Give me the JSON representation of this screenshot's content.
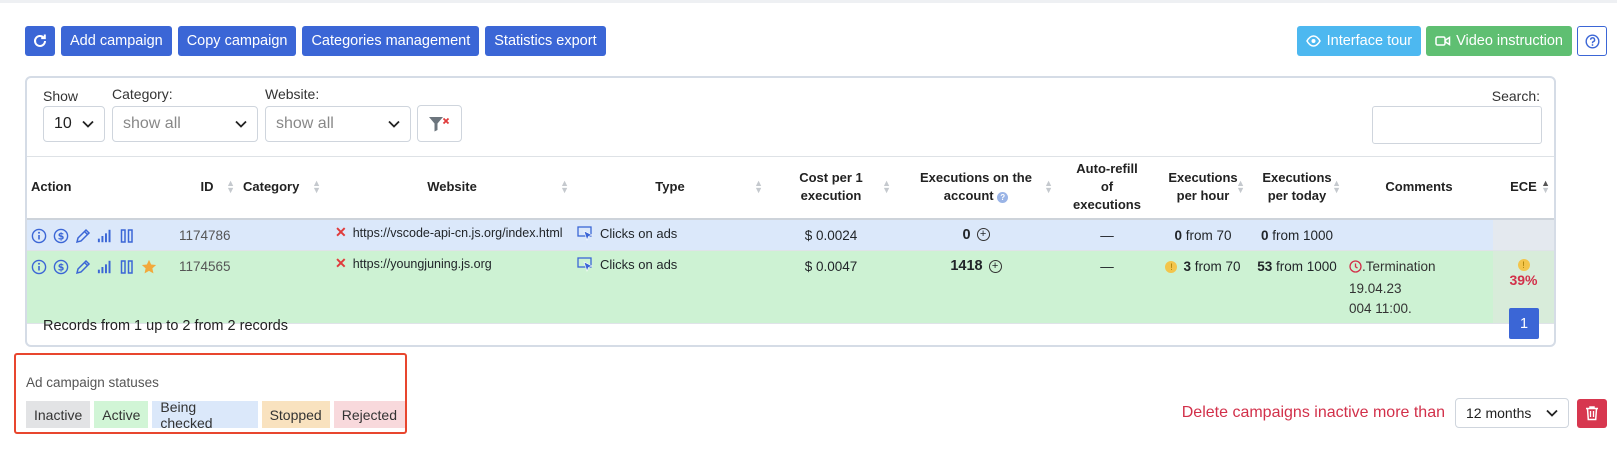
{
  "toolbar": {
    "add_campaign": "Add campaign",
    "copy_campaign": "Copy campaign",
    "categories_management": "Categories management",
    "statistics_export": "Statistics export",
    "interface_tour": "Interface tour",
    "video_instruction": "Video instruction"
  },
  "filters": {
    "show_label": "Show",
    "show_value": "10",
    "category_label": "Category:",
    "category_value": "show all",
    "website_label": "Website:",
    "website_value": "show all",
    "search_label": "Search:",
    "search_value": ""
  },
  "table": {
    "headers": {
      "action": "Action",
      "id": "ID",
      "category": "Category",
      "website": "Website",
      "type": "Type",
      "cost_l1": "Cost per 1",
      "cost_l2": "execution",
      "exec_account_l1": "Executions on the",
      "exec_account_l2": "account",
      "autorefill_l1": "Auto-refill",
      "autorefill_l2": "of",
      "autorefill_l3": "executions",
      "per_hour_l1": "Executions",
      "per_hour_l2": "per hour",
      "per_today_l1": "Executions",
      "per_today_l2": "per today",
      "comments": "Comments",
      "ece": "ECE"
    },
    "rows": [
      {
        "id": "1174786",
        "website": "https://vscode-api-cn.js.org/index.html",
        "type": "Clicks on ads",
        "cost": "$ 0.0024",
        "exec_account": "0",
        "autorefill": "—",
        "per_hour_num": "0",
        "per_hour_from": "from 70",
        "per_today_num": "0",
        "per_today_from": "from 1000",
        "comment_l1": "",
        "comment_l2": "",
        "ece": "",
        "status": "Being checked"
      },
      {
        "id": "1174565",
        "website": "https://youngjuning.js.org",
        "type": "Clicks on ads",
        "cost": "$ 0.0047",
        "exec_account": "1418",
        "autorefill": "—",
        "per_hour_num": "3",
        "per_hour_from": "from 70",
        "per_today_num": "53",
        "per_today_from": "from 1000",
        "comment_l1": ".Termination 19.04.23",
        "comment_l2": "004 11:00.",
        "ece": "39%",
        "status": "Active"
      }
    ]
  },
  "footer": {
    "records": "Records from 1 up to 2 from 2 records",
    "page": "1"
  },
  "legend": {
    "title": "Ad campaign statuses",
    "statuses": [
      {
        "label": "Inactive",
        "color": "#e2e3e5"
      },
      {
        "label": "Active",
        "color": "#d1f5d6"
      },
      {
        "label": "Being checked",
        "color": "#dbe8fa"
      },
      {
        "label": "Stopped",
        "color": "#f9e2bf"
      },
      {
        "label": "Rejected",
        "color": "#f8d9dc"
      }
    ]
  },
  "delete": {
    "text": "Delete campaigns inactive more than",
    "period": "12 months"
  },
  "colors": {
    "primary": "#3b66d6",
    "info": "#4db8f0",
    "success": "#5fbf72",
    "danger": "#d7374f",
    "legend_border": "#e8462e"
  }
}
